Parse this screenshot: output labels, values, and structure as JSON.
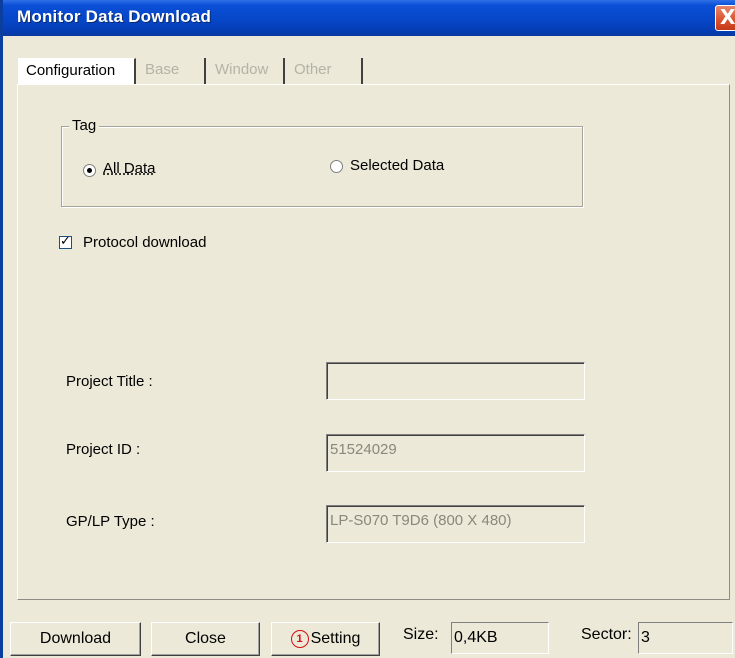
{
  "window": {
    "title": "Monitor Data Download",
    "close_label": "X"
  },
  "tabs": [
    {
      "label": "Configuration",
      "state": "active"
    },
    {
      "label": "Base",
      "state": "disabled"
    },
    {
      "label": "Window",
      "state": "disabled"
    },
    {
      "label": "Other",
      "state": "disabled"
    }
  ],
  "tag_group": {
    "label": "Tag",
    "options": [
      {
        "label": "All Data",
        "selected": true
      },
      {
        "label": "Selected Data",
        "selected": false
      }
    ]
  },
  "protocol_download": {
    "label": "Protocol download",
    "checked": true
  },
  "project": {
    "title_label": "Project Title :",
    "title_value": "",
    "id_label": "Project ID  :",
    "id_value": "51524029",
    "type_label": "GP/LP Type :",
    "type_value": "LP-S070  T9D6  (800 X 480)"
  },
  "footer": {
    "download_label": "Download",
    "close_label": "Close",
    "setting_icon_text": "1",
    "setting_label": "Setting",
    "size_label": "Size:",
    "size_value": "0,4KB",
    "sector_label": "Sector:",
    "sector_value": "3"
  }
}
